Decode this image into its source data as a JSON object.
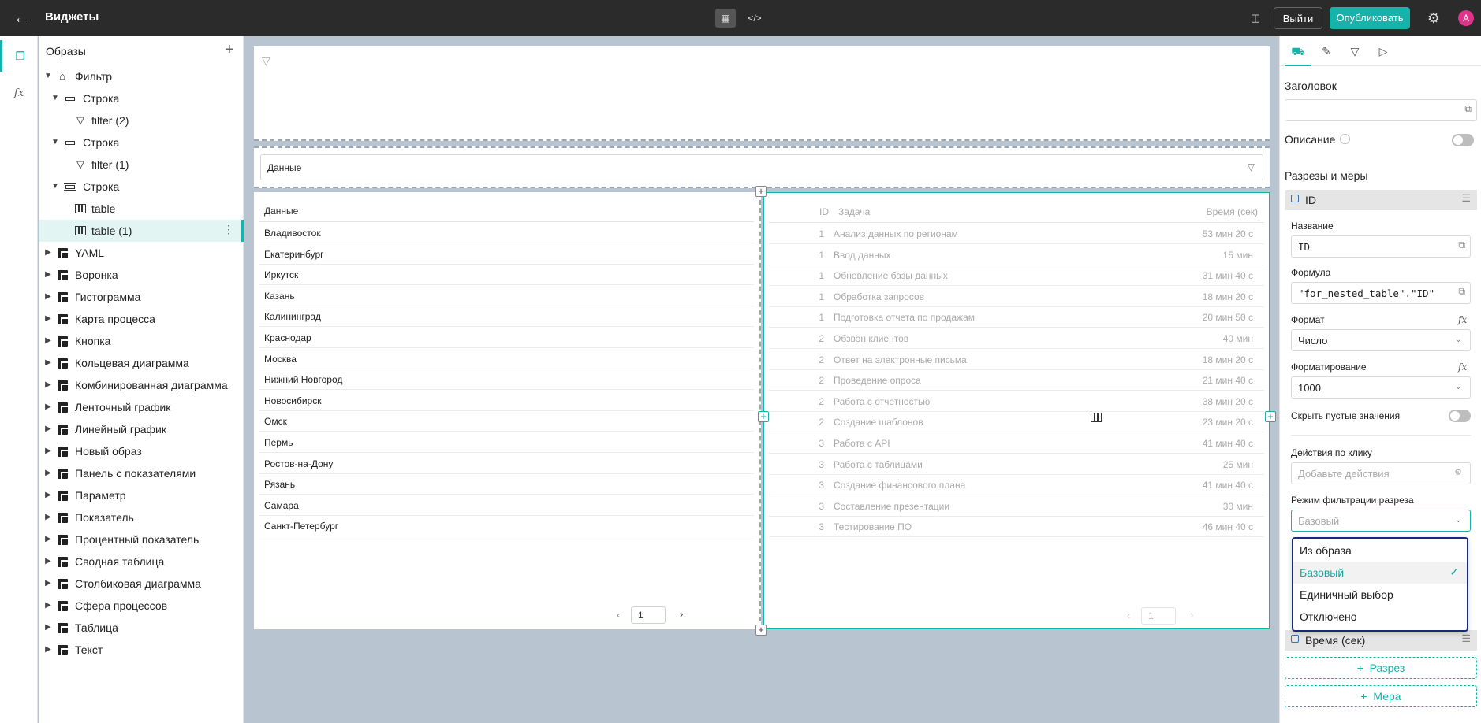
{
  "header": {
    "back_icon": "arrow-left-icon",
    "title": "Виджеты",
    "exit_label": "Выйти",
    "publish_label": "Опубликовать",
    "avatar_letter": "A",
    "accent_color": "#16b3aa",
    "avatar_color": "#e0338a"
  },
  "tree": {
    "title": "Образы",
    "items": [
      {
        "label": "Фильтр",
        "icon": "home-icon"
      },
      {
        "label": "Строка",
        "icon": "row-icon"
      },
      {
        "label": "filter (2)",
        "icon": "filter-icon"
      },
      {
        "label": "Строка",
        "icon": "row-icon"
      },
      {
        "label": "filter (1)",
        "icon": "filter-icon"
      },
      {
        "label": "Строка",
        "icon": "row-icon"
      },
      {
        "label": "table",
        "icon": "table-icon"
      },
      {
        "label": "table (1)",
        "icon": "table-icon"
      },
      {
        "label": "YAML",
        "icon": "block-icon"
      },
      {
        "label": "Воронка",
        "icon": "block-icon"
      },
      {
        "label": "Гистограмма",
        "icon": "block-icon"
      },
      {
        "label": "Карта процесса",
        "icon": "block-icon"
      },
      {
        "label": "Кнопка",
        "icon": "block-icon"
      },
      {
        "label": "Кольцевая диаграмма",
        "icon": "block-icon"
      },
      {
        "label": "Комбинированная диаграмма",
        "icon": "block-icon"
      },
      {
        "label": "Ленточный график",
        "icon": "block-icon"
      },
      {
        "label": "Линейный график",
        "icon": "block-icon"
      },
      {
        "label": "Новый образ",
        "icon": "block-icon"
      },
      {
        "label": "Панель с показателями",
        "icon": "block-icon"
      },
      {
        "label": "Параметр",
        "icon": "block-icon"
      },
      {
        "label": "Показатель",
        "icon": "block-icon"
      },
      {
        "label": "Процентный показатель",
        "icon": "block-icon"
      },
      {
        "label": "Сводная таблица",
        "icon": "block-icon"
      },
      {
        "label": "Столбиковая диаграмма",
        "icon": "block-icon"
      },
      {
        "label": "Сфера процессов",
        "icon": "block-icon"
      },
      {
        "label": "Таблица",
        "icon": "block-icon"
      },
      {
        "label": "Текст",
        "icon": "block-icon"
      }
    ]
  },
  "canvas": {
    "filter_select_label": "Данные",
    "left_table": {
      "header": "Данные",
      "rows": [
        "Владивосток",
        "Екатеринбург",
        "Иркутск",
        "Казань",
        "Калининград",
        "Краснодар",
        "Москва",
        "Нижний Новгород",
        "Новосибирск",
        "Омск",
        "Пермь",
        "Ростов-на-Дону",
        "Рязань",
        "Самара",
        "Санкт-Петербург"
      ],
      "page": "1"
    },
    "right_table": {
      "columns": [
        "ID",
        "Задача",
        "Время (сек)"
      ],
      "rows": [
        [
          "1",
          "Анализ данных по регионам",
          "53 мин 20 с"
        ],
        [
          "1",
          "Ввод данных",
          "15 мин"
        ],
        [
          "1",
          "Обновление базы данных",
          "31 мин 40 с"
        ],
        [
          "1",
          "Обработка запросов",
          "18 мин 20 с"
        ],
        [
          "1",
          "Подготовка отчета по продажам",
          "20 мин 50 с"
        ],
        [
          "2",
          "Обзвон клиентов",
          "40 мин"
        ],
        [
          "2",
          "Ответ на электронные письма",
          "18 мин 20 с"
        ],
        [
          "2",
          "Проведение опроса",
          "21 мин 40 с"
        ],
        [
          "2",
          "Работа с отчетностью",
          "38 мин 20 с"
        ],
        [
          "2",
          "Создание шаблонов",
          "23 мин 20 с"
        ],
        [
          "3",
          "Работа с API",
          "41 мин 40 с"
        ],
        [
          "3",
          "Работа с таблицами",
          "25 мин"
        ],
        [
          "3",
          "Создание финансового плана",
          "41 мин 40 с"
        ],
        [
          "3",
          "Составление презентации",
          "30 мин"
        ],
        [
          "3",
          "Тестирование ПО",
          "46 мин 40 с"
        ]
      ],
      "page": "1"
    }
  },
  "props": {
    "title_label": "Заголовок",
    "title_value": "",
    "description_label": "Описание",
    "dims_label": "Разрезы и меры",
    "dim_id": "ID",
    "name_label": "Название",
    "name_value": "ID",
    "formula_label": "Формула",
    "formula_value": "\"for_nested_table\".\"ID\"",
    "format_label": "Формат",
    "format_value": "Число",
    "formatting_label": "Форматирование",
    "formatting_value": "1000",
    "hide_empty_label": "Скрыть пустые значения",
    "click_actions_label": "Действия по клику",
    "click_actions_placeholder": "Добавьте действия",
    "filter_mode_label": "Режим фильтрации разреза",
    "filter_mode_value": "Базовый",
    "filter_mode_options": [
      "Из образа",
      "Базовый",
      "Единичный выбор",
      "Отключено"
    ],
    "dim_time": "Время (сек)",
    "add_dim_label": "Разрез",
    "add_measure_label": "Мера"
  }
}
